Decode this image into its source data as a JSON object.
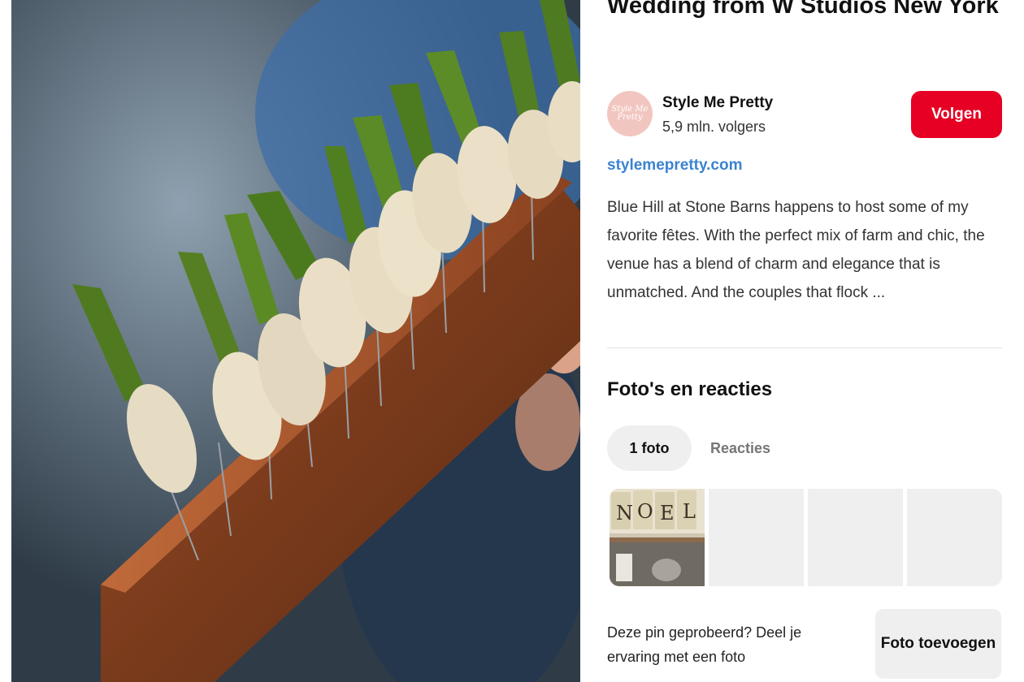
{
  "pin": {
    "title": "Wedding from W Studios New York",
    "image_alt": "Asparagus appetizers on skewers in a wooden board"
  },
  "creator": {
    "avatar_text": "Style Me Pretty",
    "name": "Style Me Pretty",
    "followers": "5,9 mln. volgers",
    "follow_label": "Volgen"
  },
  "source": {
    "link_text": "stylemepretty.com"
  },
  "description": "Blue Hill at Stone Barns happens to host some of my favorite fêtes. With the perfect mix of farm and chic, the venue has a blend of charm and elegance that is unmatched. And the couples that flock ...",
  "comments": {
    "heading": "Foto's en reacties",
    "tabs": [
      {
        "label": "1 foto",
        "active": true
      },
      {
        "label": "Reacties",
        "active": false
      }
    ],
    "photo_thumb_text": "NOEL"
  },
  "tried": {
    "prompt": "Deze pin geprobeerd? Deel je ervaring met een foto",
    "add_photo_label": "Foto toevoegen"
  },
  "colors": {
    "follow_button": "#e60023",
    "link": "#3b83d0"
  }
}
